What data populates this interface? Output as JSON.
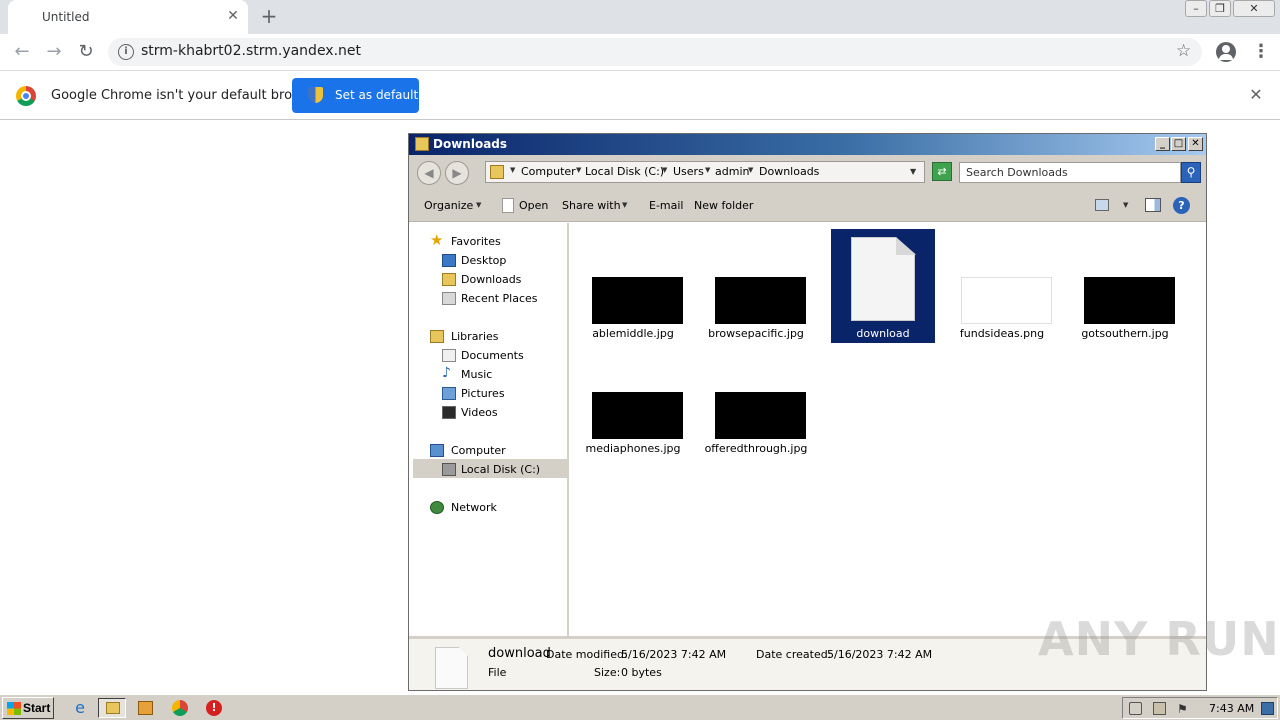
{
  "browser": {
    "tab_title": "Untitled",
    "url": "strm-khabrt02.strm.yandex.net",
    "infobar_text": "Google Chrome isn't your default browser",
    "set_default_label": "Set as default"
  },
  "explorer": {
    "title": "Downloads",
    "breadcrumbs": [
      "Computer",
      "Local Disk (C:)",
      "Users",
      "admin",
      "Downloads"
    ],
    "search_placeholder": "Search Downloads",
    "commands": {
      "organize": "Organize",
      "open": "Open",
      "share_with": "Share with",
      "email": "E-mail",
      "new_folder": "New folder"
    },
    "nav": {
      "favorites": "Favorites",
      "desktop": "Desktop",
      "downloads": "Downloads",
      "recent_places": "Recent Places",
      "libraries": "Libraries",
      "documents": "Documents",
      "music": "Music",
      "pictures": "Pictures",
      "videos": "Videos",
      "computer": "Computer",
      "local_disk": "Local Disk (C:)",
      "network": "Network"
    },
    "files": [
      {
        "name": "ablemiddle.jpg",
        "thumb": "dark"
      },
      {
        "name": "browsepacific.jpg",
        "thumb": "dark"
      },
      {
        "name": "download",
        "thumb": "document",
        "selected": true
      },
      {
        "name": "fundsideas.png",
        "thumb": "light"
      },
      {
        "name": "gotsouthern.jpg",
        "thumb": "dark"
      },
      {
        "name": "mediaphones.jpg",
        "thumb": "dark"
      },
      {
        "name": "offeredthrough.jpg",
        "thumb": "dark"
      }
    ],
    "details": {
      "name": "download",
      "type": "File",
      "modified_label": "Date modified:",
      "modified_value": "5/16/2023 7:42 AM",
      "created_label": "Date created:",
      "created_value": "5/16/2023 7:42 AM",
      "size_label": "Size:",
      "size_value": "0 bytes"
    }
  },
  "taskbar": {
    "start_label": "Start",
    "clock": "7:43 AM"
  },
  "watermark": "ANY RUN",
  "colors": {
    "chrome_blue": "#1a73e8",
    "selection": "#0a246a",
    "classic_gray": "#d4d0c8"
  }
}
